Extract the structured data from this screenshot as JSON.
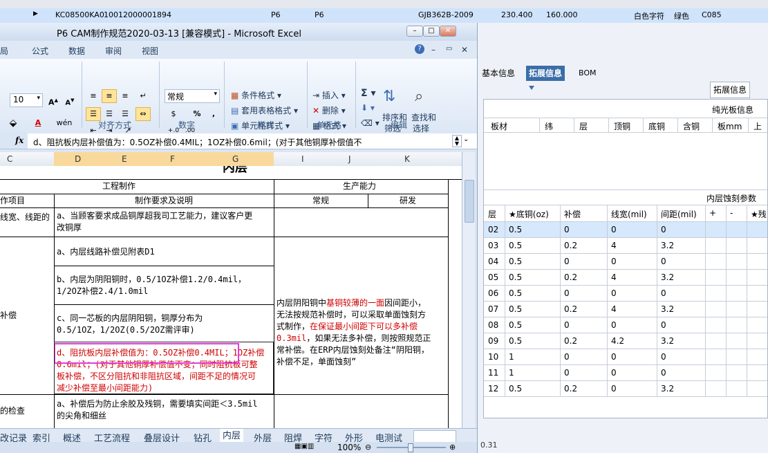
{
  "top_row": {
    "marker": "▶",
    "code": "KC08500KA0",
    "num": "10012000001894",
    "c1": "P6",
    "c2": "P6",
    "std": "GJB362B-2009",
    "v1": "230.400",
    "v2": "160.000",
    "txt1": "白色字符",
    "txt2": "绿色",
    "code2": "C085"
  },
  "excel": {
    "title": "P6 CAM制作规范2020-03-13 [兼容模式] - Microsoft Excel",
    "menu": [
      "局",
      "公式",
      "数据",
      "审阅",
      "视图"
    ],
    "font_size": "10",
    "number_format": "常规",
    "ribbon": {
      "cond_format": "条件格式",
      "table_format": "套用表格格式",
      "cell_style": "单元格样式",
      "insert": "插入",
      "delete": "删除",
      "format": "格式",
      "sort_filter_1": "排序和",
      "sort_filter_2": "筛选",
      "find_select_1": "查找和",
      "find_select_2": "选择",
      "groups": [
        "对齐方式",
        "数字",
        "样式",
        "单元格",
        "编辑"
      ],
      "percent": "%",
      "comma": ","
    },
    "formula_text": "d、阻抗板内层补偿值为：0.5OZ补偿0.4MIL；1OZ补偿0.6mil；(对于其他铜厚补偿值不",
    "columns": [
      "C",
      "D",
      "E",
      "F",
      "G",
      "I",
      "J",
      "K"
    ],
    "sheet": {
      "top_partial": "内层",
      "hdr_eng": "工程制作",
      "hdr_prod": "生产能力",
      "hdr_item": "作项目",
      "hdr_req": "制作要求及说明",
      "hdr_normal": "常规",
      "hdr_rd": "研发",
      "item1": "线宽、线距的",
      "item2": "补偿",
      "item3": "的检查",
      "a1_l1": "a、当顾客要求成品铜厚超我司工艺能力，建议客户更",
      "a1_l2": "改铜厚",
      "a2": "a、内层线路补偿见附表D1",
      "b_l1": "b、内层为阴阳铜时，0.5/1OZ补偿1.2/0.4mil，",
      "b_l2": "1/2OZ补偿2.4/1.0mil",
      "c_l1": "c、同一芯板的内层阴阳铜，铜厚分布为",
      "c_l2": "0.5/1OZ，1/2OZ(0.5/2OZ需评审)",
      "d_l1": "d、阻抗板内层补偿值为：0.5OZ补偿0.4MIL；1OZ补偿",
      "d_l2": "0.6mil；(对于其他铜厚补偿值不变；同时阻抗板可整",
      "d_l3": "板补偿，不区分阻抗和非阻抗区域，间距不足的情况可",
      "d_l4": "减少补偿至最小间距能力)",
      "e_l1": "a、补偿后为防止余胶及残铜，需要填实间距＜3.5mil",
      "e_l2": "的尖角和细丝",
      "right_l1a": "内层阴阳铜中",
      "right_l1b": "基铜较薄的一面",
      "right_l1c": "因间距小，",
      "right_l2": "无法按规范补偿时，可以采取单面蚀刻方",
      "right_l3a": "式制作，",
      "right_l3b": "在保证最小间距下可以多补偿",
      "right_l4a": "0.3mil",
      "right_l4b": "，如果无法多补偿，则按照规范正",
      "right_l5": "常补偿。在ERP内层蚀刻处备注“阴阳铜，",
      "right_l6": "补偿不足，单面蚀刻”"
    },
    "tabs": [
      "改记录",
      "索引",
      "概述",
      "工艺流程",
      "叠层设计",
      "钻孔",
      "内层",
      "外层",
      "阻焊",
      "字符",
      "外形",
      "电测试"
    ],
    "zoom": "100%"
  },
  "panel": {
    "tabs": [
      "基本信息",
      "拓展信息",
      "BOM"
    ],
    "active_tab": "拓展信息",
    "subtab": "拓展信息",
    "board_title": "纯光板信息",
    "board_cols": [
      "板材",
      "纬",
      "层",
      "顶铜",
      "底铜",
      "含铜",
      "板mm",
      "上"
    ],
    "etch_title": "内层蚀刻参数",
    "etch_cols": [
      "层",
      "★底铜(oz)",
      "补偿",
      "线宽(mil)",
      "间距(mil)",
      "+",
      "-",
      "★残"
    ],
    "etch_rows": [
      [
        "02",
        "0.5",
        "0",
        "0",
        "0"
      ],
      [
        "03",
        "0.5",
        "0.2",
        "4",
        "3.2"
      ],
      [
        "04",
        "0.5",
        "0",
        "0",
        "0"
      ],
      [
        "05",
        "0.5",
        "0.2",
        "4",
        "3.2"
      ],
      [
        "06",
        "0.5",
        "0",
        "0",
        "0"
      ],
      [
        "07",
        "0.5",
        "0.2",
        "4",
        "3.2"
      ],
      [
        "08",
        "0.5",
        "0",
        "0",
        "0"
      ],
      [
        "09",
        "0.5",
        "0.2",
        "4.2",
        "3.2"
      ],
      [
        "10",
        "1",
        "0",
        "0",
        "0"
      ],
      [
        "11",
        "1",
        "0",
        "0",
        "0"
      ],
      [
        "12",
        "0.5",
        "0.2",
        "0",
        "3.2"
      ]
    ],
    "footer_value": "0.31"
  }
}
